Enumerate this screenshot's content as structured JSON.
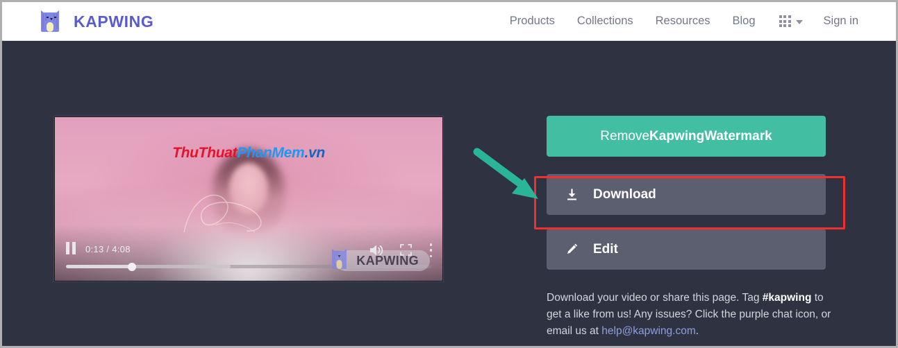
{
  "brand": {
    "name": "KAPWING",
    "logo_icon": "kapwing-cat-logo",
    "accent_color": "#5a5ad1"
  },
  "nav": {
    "links": [
      {
        "label": "Products"
      },
      {
        "label": "Collections"
      },
      {
        "label": "Resources"
      },
      {
        "label": "Blog"
      }
    ],
    "apps_icon": "apps-grid-icon",
    "apps_caret_icon": "chevron-down-icon",
    "sign_in_label": "Sign in"
  },
  "video": {
    "watermark_text": {
      "part1": "ThuThuat",
      "part2": "PhanMem",
      "part3": ".vn"
    },
    "overlay_watermark": "KAPWING",
    "overlay_logo_icon": "kapwing-cat-logo",
    "controls": {
      "pause_icon": "pause-icon",
      "current_time": "0:13",
      "separator": "/",
      "duration": "4:08",
      "time_display": "0:13 / 4:08",
      "volume_icon": "volume-on-icon",
      "fullscreen_icon": "fullscreen-icon",
      "more_icon": "more-vertical-icon",
      "progress_percent": 17
    }
  },
  "actions": {
    "remove_watermark": {
      "prefix": "Remove ",
      "brand": "Kapwing",
      "suffix": " Watermark",
      "color": "#42bfa3"
    },
    "download": {
      "label": "Download",
      "icon": "download-icon"
    },
    "edit": {
      "label": "Edit",
      "icon": "pencil-icon"
    }
  },
  "annotations": {
    "highlight_color": "#f03030",
    "arrow_color": "#2bb598",
    "highlight_target": "download-button"
  },
  "footer": {
    "line1": "Download your video or share this page. Tag",
    "tag": "#kapwing",
    "line2_rest": " to get a like from us! Any issues? Click the",
    "line3_prefix": "purple chat icon, or email us at ",
    "email": "help@kapwing.com",
    "period": "."
  }
}
